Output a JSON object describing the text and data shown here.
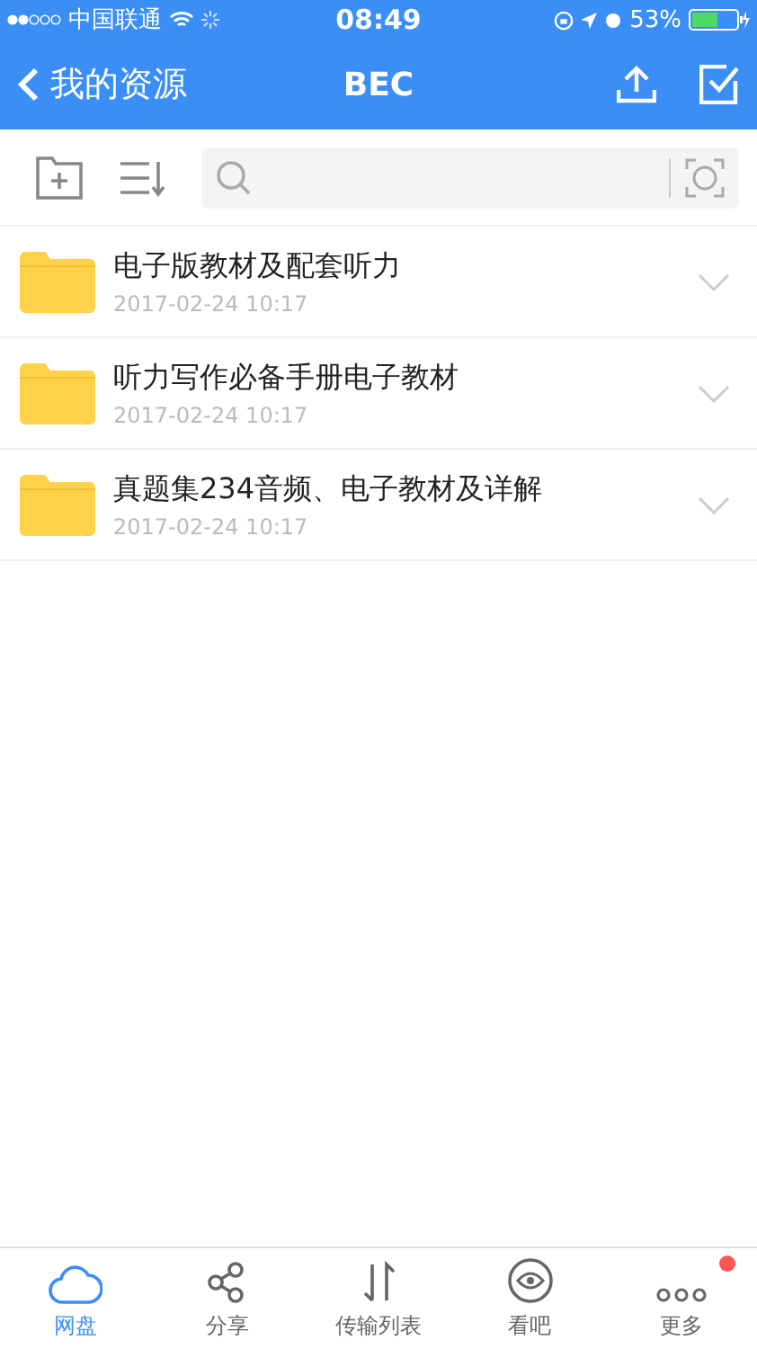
{
  "status_bar": {
    "carrier": "中国联通",
    "time": "08:49",
    "battery": "53%"
  },
  "nav": {
    "back": "我的资源",
    "title": "BEC"
  },
  "files": [
    {
      "name": "电子版教材及配套听力",
      "date": "2017-02-24 10:17"
    },
    {
      "name": "听力写作必备手册电子教材",
      "date": "2017-02-24 10:17"
    },
    {
      "name": "真题集234音频、电子教材及详解",
      "date": "2017-02-24 10:17"
    }
  ],
  "tabs": [
    {
      "kind": "cloud",
      "label": "网盘",
      "selected": true,
      "badge": false
    },
    {
      "kind": "share",
      "label": "分享",
      "selected": false,
      "badge": false
    },
    {
      "kind": "transfer",
      "label": "传输列表",
      "selected": false,
      "badge": false
    },
    {
      "kind": "eye",
      "label": "看吧",
      "selected": false,
      "badge": false
    },
    {
      "kind": "more",
      "label": "更多",
      "selected": false,
      "badge": true
    }
  ]
}
